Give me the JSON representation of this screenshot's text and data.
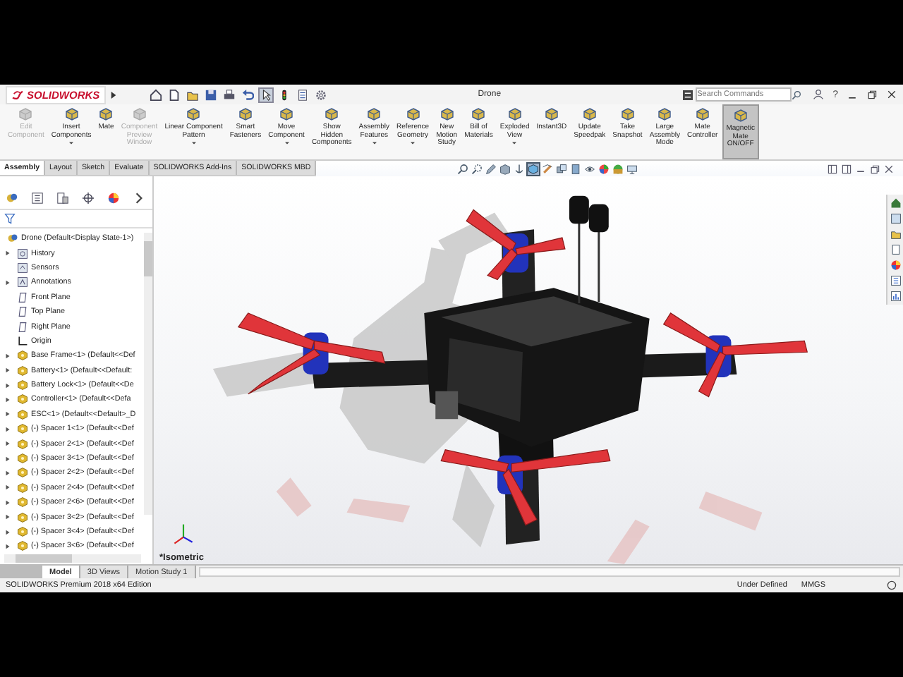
{
  "window": {
    "logo": "SOLIDWORKS",
    "title": "Drone",
    "search": {
      "placeholder": "Search Commands"
    },
    "help_label": "?"
  },
  "ribbon": [
    {
      "label": "Edit\nComponent",
      "disabled": true,
      "dropdown": false,
      "on": false
    },
    {
      "label": "Insert\nComponents",
      "disabled": false,
      "dropdown": true,
      "on": false
    },
    {
      "label": "Mate",
      "disabled": false,
      "dropdown": false,
      "on": false
    },
    {
      "label": "Component\nPreview\nWindow",
      "disabled": true,
      "dropdown": false,
      "on": false
    },
    {
      "label": "Linear Component\nPattern",
      "disabled": false,
      "dropdown": true,
      "on": false
    },
    {
      "label": "Smart\nFasteners",
      "disabled": false,
      "dropdown": false,
      "on": false
    },
    {
      "label": "Move\nComponent",
      "disabled": false,
      "dropdown": true,
      "on": false
    },
    {
      "label": "Show\nHidden\nComponents",
      "disabled": false,
      "dropdown": false,
      "on": false
    },
    {
      "label": "Assembly\nFeatures",
      "disabled": false,
      "dropdown": true,
      "on": false
    },
    {
      "label": "Reference\nGeometry",
      "disabled": false,
      "dropdown": true,
      "on": false
    },
    {
      "label": "New\nMotion\nStudy",
      "disabled": false,
      "dropdown": false,
      "on": false
    },
    {
      "label": "Bill of\nMaterials",
      "disabled": false,
      "dropdown": false,
      "on": false
    },
    {
      "label": "Exploded\nView",
      "disabled": false,
      "dropdown": true,
      "on": false
    },
    {
      "label": "Instant3D",
      "disabled": false,
      "dropdown": false,
      "on": false
    },
    {
      "label": "Update\nSpeedpak",
      "disabled": false,
      "dropdown": false,
      "on": false
    },
    {
      "label": "Take\nSnapshot",
      "disabled": false,
      "dropdown": false,
      "on": false
    },
    {
      "label": "Large\nAssembly\nMode",
      "disabled": false,
      "dropdown": false,
      "on": false
    },
    {
      "label": "Mate\nController",
      "disabled": false,
      "dropdown": false,
      "on": false
    },
    {
      "label": "Magnetic\nMate\nON/OFF",
      "disabled": false,
      "dropdown": false,
      "on": true
    }
  ],
  "command_tabs": [
    {
      "label": "Assembly",
      "selected": true
    },
    {
      "label": "Layout",
      "selected": false
    },
    {
      "label": "Sketch",
      "selected": false
    },
    {
      "label": "Evaluate",
      "selected": false
    },
    {
      "label": "SOLIDWORKS Add-Ins",
      "selected": false
    },
    {
      "label": "SOLIDWORKS MBD",
      "selected": false
    }
  ],
  "feature_tree": {
    "root": "Drone  (Default<Display State-1>)",
    "items": [
      {
        "kind": "history",
        "label": "History",
        "expandable": true
      },
      {
        "kind": "sensors",
        "label": "Sensors",
        "expandable": false
      },
      {
        "kind": "annotations",
        "label": "Annotations",
        "expandable": true
      },
      {
        "kind": "plane",
        "label": "Front Plane",
        "expandable": false
      },
      {
        "kind": "plane",
        "label": "Top Plane",
        "expandable": false
      },
      {
        "kind": "plane",
        "label": "Right Plane",
        "expandable": false
      },
      {
        "kind": "origin",
        "label": "Origin",
        "expandable": false
      },
      {
        "kind": "part",
        "label": "Base Frame<1> (Default<<Def",
        "expandable": true
      },
      {
        "kind": "part",
        "label": "Battery<1> (Default<<Default:",
        "expandable": true
      },
      {
        "kind": "part",
        "label": "Battery Lock<1> (Default<<De",
        "expandable": true
      },
      {
        "kind": "part",
        "label": "Controller<1> (Default<<Defa",
        "expandable": true
      },
      {
        "kind": "part",
        "label": "ESC<1> (Default<<Default>_D",
        "expandable": true
      },
      {
        "kind": "part",
        "label": "(-) Spacer 1<1> (Default<<Def",
        "expandable": true
      },
      {
        "kind": "part",
        "label": "(-) Spacer 2<1> (Default<<Def",
        "expandable": true
      },
      {
        "kind": "part",
        "label": "(-) Spacer 3<1> (Default<<Def",
        "expandable": true
      },
      {
        "kind": "part",
        "label": "(-) Spacer 2<2> (Default<<Def",
        "expandable": true
      },
      {
        "kind": "part",
        "label": "(-) Spacer 2<4> (Default<<Def",
        "expandable": true
      },
      {
        "kind": "part",
        "label": "(-) Spacer 2<6> (Default<<Def",
        "expandable": true
      },
      {
        "kind": "part",
        "label": "(-) Spacer 3<2> (Default<<Def",
        "expandable": true
      },
      {
        "kind": "part",
        "label": "(-) Spacer 3<4> (Default<<Def",
        "expandable": true
      },
      {
        "kind": "part",
        "label": "(-) Spacer 3<6> (Default<<Def",
        "expandable": true
      }
    ]
  },
  "viewport": {
    "view_name": "*Isometric"
  },
  "bottom_tabs": [
    {
      "label": "Model",
      "selected": true
    },
    {
      "label": "3D Views",
      "selected": false
    },
    {
      "label": "Motion Study 1",
      "selected": false
    }
  ],
  "status_bar": {
    "edition": "SOLIDWORKS Premium 2018 x64 Edition",
    "state": "Under Defined",
    "units": "MMGS"
  }
}
